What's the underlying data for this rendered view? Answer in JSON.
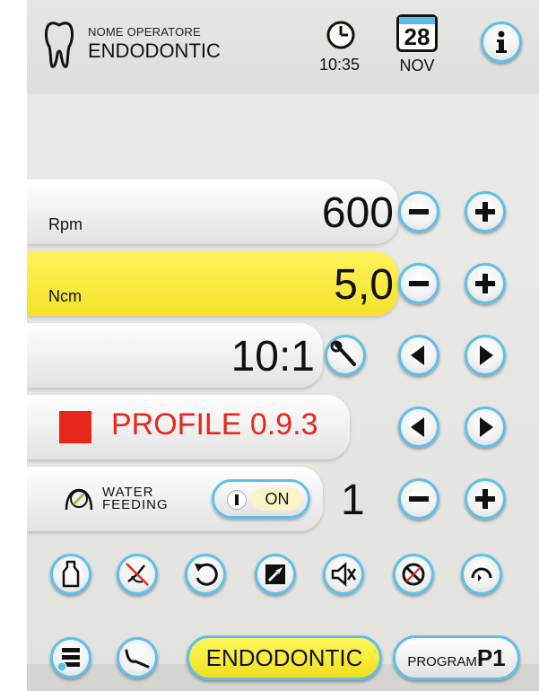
{
  "header": {
    "operator_label": "NOME OPERATORE",
    "operator_name": "ENDODONTIC",
    "time": "10:35",
    "date_day": "28",
    "date_month": "NOV"
  },
  "rows": {
    "speed": {
      "label": "Rpm",
      "value": "600"
    },
    "torque": {
      "label": "Ncm",
      "value": "5,0"
    },
    "ratio": {
      "value": "10:1"
    },
    "profile": {
      "name": "PROFILE 0.9.3",
      "color": "#e8261c"
    },
    "water": {
      "label_line1": "WATER",
      "label_line2": "FEEDING",
      "toggle_on": "ON",
      "level": "1"
    }
  },
  "footer": {
    "mode_label": "ENDODONTIC",
    "program_prefix": "PROGRAM",
    "program_id": "P1"
  },
  "icons": [
    "tooth-icon",
    "clock-icon",
    "calendar-icon",
    "info-icon",
    "minus-icon",
    "plus-icon",
    "wrench-icon",
    "arrow-left-icon",
    "arrow-right-icon",
    "water-icon",
    "bottle-icon",
    "spray-off-icon",
    "reverse-icon",
    "auto-forward-icon",
    "mute-icon",
    "disabled-icon",
    "auto-reverse-icon",
    "menu-list-icon",
    "handpiece-icon"
  ],
  "colors": {
    "accent": "#5cc0ea",
    "highlight": "#f3e32a",
    "profile": "#e8261c"
  }
}
